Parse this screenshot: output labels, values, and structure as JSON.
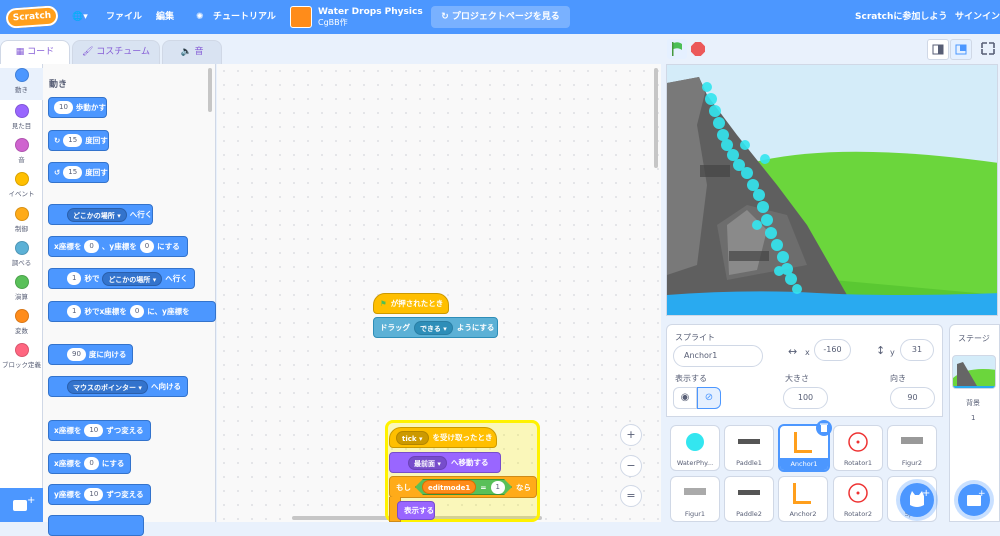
{
  "menu": {
    "logo": "Scratch",
    "file": "ファイル",
    "edit": "編集",
    "tutorial": "チュートリアル",
    "project_title": "Water Drops Physics",
    "author": "CgBB作",
    "see_project": "プロジェクトページを見る",
    "join": "Scratchに参加しよう",
    "signin": "サインイン"
  },
  "tabs": {
    "code": "コード",
    "costume": "コスチューム",
    "sound": "音"
  },
  "categories": [
    {
      "label": "動き",
      "color": "#4c97ff"
    },
    {
      "label": "見た目",
      "color": "#9966ff"
    },
    {
      "label": "音",
      "color": "#cf63cf"
    },
    {
      "label": "イベント",
      "color": "#ffbf00"
    },
    {
      "label": "制御",
      "color": "#ffab19"
    },
    {
      "label": "調べる",
      "color": "#5cb1d6"
    },
    {
      "label": "演算",
      "color": "#59c059"
    },
    {
      "label": "変数",
      "color": "#ff8c1a"
    },
    {
      "label": "ブロック定義",
      "color": "#ff6680"
    }
  ],
  "palette": {
    "title": "動き",
    "move_val": "10",
    "move": "歩動かす",
    "turn_r_val": "15",
    "turn_r": "度回す",
    "turn_l_val": "15",
    "turn_l": "度回す",
    "goto_drop": "どこかの場所",
    "goto": "へ行く",
    "goto_xy_x": "x座標を",
    "goto_xy_xval": "0",
    "goto_xy_y": "、y座標を",
    "goto_xy_yval": "0",
    "goto_xy_end": "にする",
    "glide_val": "1",
    "glide_mid": "秒で",
    "glide_drop": "どこかの場所",
    "glide_end": "へ行く",
    "glide2_val": "1",
    "glide2_mid": "秒でx座標を",
    "glide2_xval": "0",
    "glide2_end": "に、y座標を",
    "point_val": "90",
    "point": "度に向ける",
    "toward_drop": "マウスのポインター",
    "toward": "へ向ける",
    "chx": "x座標を",
    "chx_val": "10",
    "chx_end": "ずつ変える",
    "setx": "x座標を",
    "setx_val": "0",
    "setx_end": "にする",
    "chy": "y座標を",
    "chy_val": "10",
    "chy_end": "ずつ変える"
  },
  "script1": {
    "hat": "が押されたとき",
    "drag": "ドラッグ",
    "drag_drop": "できる",
    "drag_end": "ようにする"
  },
  "script2": {
    "recv_drop": "tick",
    "recv": "を受け取ったとき",
    "front_drop": "最前面",
    "front": "へ移動する",
    "if": "もし",
    "var": "editmode1",
    "eq": "=",
    "val": "1",
    "then": "なら",
    "show": "表示する"
  },
  "zoom": {
    "in": "+",
    "out": "−",
    "reset": "="
  },
  "sprite_info": {
    "sprite_label": "スプライト",
    "name": "Anchor1",
    "x_label": "x",
    "x": "-160",
    "y_label": "y",
    "y": "31",
    "show_label": "表示する",
    "size_label": "大きさ",
    "size": "100",
    "dir_label": "向き",
    "dir": "90"
  },
  "stage_panel": {
    "title": "ステージ",
    "bg_label": "背景",
    "bg_count": "1"
  },
  "sprites": [
    "WaterPhy...",
    "Paddle1",
    "Anchor1",
    "Rotator1",
    "Figur2",
    "Figur1",
    "Paddle2",
    "Anchor2",
    "Rotator2",
    "Sp..."
  ],
  "selected_sprite": "Anchor1"
}
